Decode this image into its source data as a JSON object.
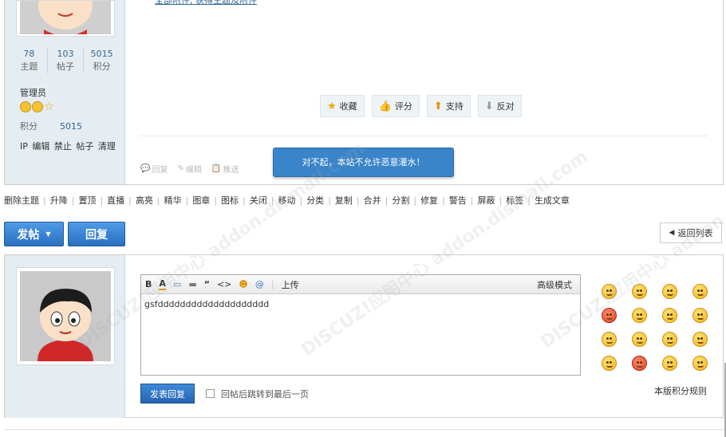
{
  "top_post": {
    "link_text": "全部附件, 获得主题及附件",
    "stats": [
      {
        "num": "78",
        "label": "主题"
      },
      {
        "num": "103",
        "label": "帖子"
      },
      {
        "num": "5015",
        "label": "积分"
      }
    ],
    "role": "管理员",
    "points_label": "积分",
    "points_value": "5015",
    "admin_links": "IP 编辑 禁止 帖子 清理",
    "vote_buttons": [
      {
        "label": "收藏",
        "icon": "star-icon"
      },
      {
        "label": "评分",
        "icon": "thumb-icon"
      },
      {
        "label": "支持",
        "icon": "arrow-up-icon"
      },
      {
        "label": "反对",
        "icon": "arrow-down-icon"
      }
    ],
    "post_actions": [
      "回复",
      "编辑",
      "推送"
    ]
  },
  "toast": "对不起，本站不允许恶意灌水！",
  "mod_links": [
    "删除主题",
    "升降",
    "置顶",
    "直播",
    "高亮",
    "精华",
    "图章",
    "图标",
    "关闭",
    "移动",
    "分类",
    "复制",
    "合并",
    "分割",
    "修复",
    "警告",
    "屏蔽",
    "标签",
    "生成文章"
  ],
  "buttons": {
    "post": "发帖",
    "reply": "回复",
    "back": "返回列表"
  },
  "editor": {
    "toolbar": [
      "B",
      "A",
      "▭",
      "▬",
      "“",
      "<>",
      "☻",
      "@"
    ],
    "upload": "上传",
    "advanced": "高级模式",
    "content": "gsfdddddddddddddddddddd"
  },
  "submit": {
    "button": "发表回复",
    "checkbox_label": "回帖后跳转到最后一页",
    "rules": "本版积分规则"
  },
  "watermark_text": "DISCUZ!应用中心 addon.dismall.com",
  "colors": {
    "accent": "#2a6fc0",
    "side_bg": "#e5edf2",
    "link": "#336699",
    "toast": "#3a84c9"
  }
}
